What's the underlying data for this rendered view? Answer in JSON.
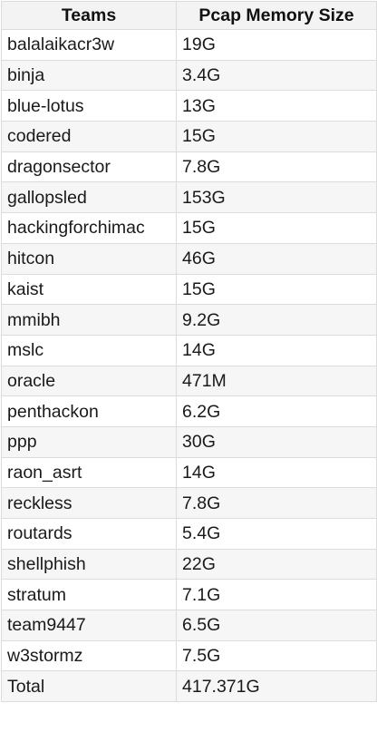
{
  "table": {
    "headers": [
      "Teams",
      "Pcap Memory Size"
    ],
    "rows": [
      [
        "balalaikacr3w",
        "19G"
      ],
      [
        "binja",
        "3.4G"
      ],
      [
        "blue-lotus",
        "13G"
      ],
      [
        "codered",
        "15G"
      ],
      [
        "dragonsector",
        "7.8G"
      ],
      [
        "gallopsled",
        "153G"
      ],
      [
        "hackingforchimac",
        "15G"
      ],
      [
        "hitcon",
        "46G"
      ],
      [
        "kaist",
        "15G"
      ],
      [
        "mmibh",
        "9.2G"
      ],
      [
        "mslc",
        "14G"
      ],
      [
        "oracle",
        "471M"
      ],
      [
        "penthackon",
        "6.2G"
      ],
      [
        "ppp",
        "30G"
      ],
      [
        "raon_asrt",
        "14G"
      ],
      [
        "reckless",
        "7.8G"
      ],
      [
        "routards",
        "5.4G"
      ],
      [
        "shellphish",
        "22G"
      ],
      [
        "stratum",
        "7.1G"
      ],
      [
        "team9447",
        "6.5G"
      ],
      [
        "w3stormz",
        "7.5G"
      ],
      [
        "Total",
        "417.371G"
      ]
    ]
  }
}
